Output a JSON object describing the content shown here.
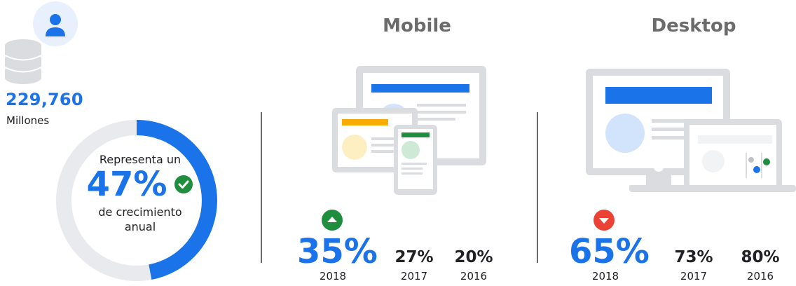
{
  "summary": {
    "total_value": "229,760",
    "total_unit": "Millones",
    "donut": {
      "line1": "Representa un",
      "percent": "47%",
      "line2_a": "de crecimiento",
      "line2_b": "anual",
      "fill_fraction": 0.47,
      "color_fill": "#1a73e8",
      "color_track": "#e8eaed"
    }
  },
  "mobile": {
    "title": "Mobile",
    "trend": "up",
    "trend_color": "#1e8e3e",
    "values": [
      {
        "pct": "35%",
        "year": "2018"
      },
      {
        "pct": "27%",
        "year": "2017"
      },
      {
        "pct": "20%",
        "year": "2016"
      }
    ]
  },
  "desktop": {
    "title": "Desktop",
    "trend": "down",
    "trend_color": "#ea4335",
    "values": [
      {
        "pct": "65%",
        "year": "2018"
      },
      {
        "pct": "73%",
        "year": "2017"
      },
      {
        "pct": "80%",
        "year": "2016"
      }
    ]
  },
  "icons": {
    "user": "user-icon",
    "database": "database-icon",
    "check": "check-circle-icon",
    "up": "arrow-up-circle-icon",
    "down": "arrow-down-circle-icon"
  }
}
